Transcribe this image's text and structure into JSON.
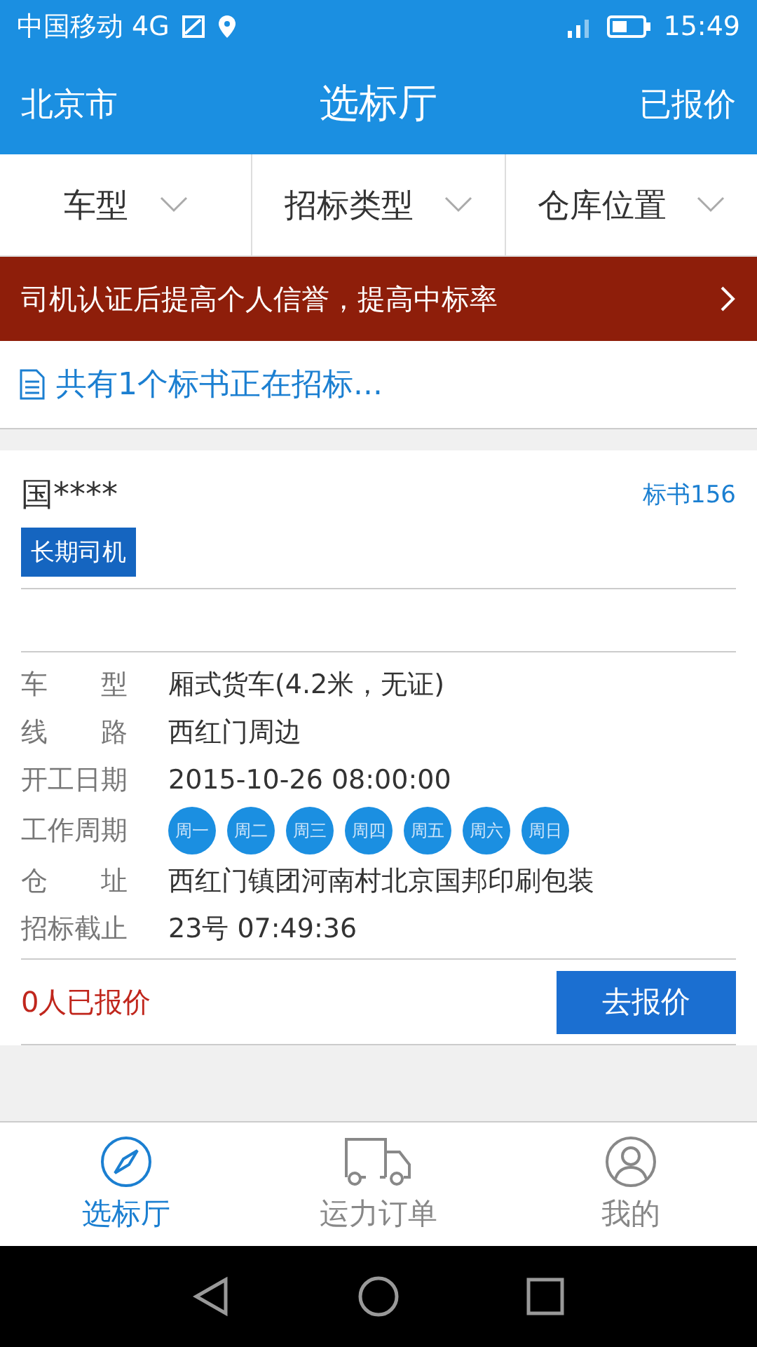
{
  "status_bar": {
    "carrier": "中国移动 4G",
    "time": "15:49"
  },
  "header": {
    "left": "北京市",
    "title": "选标厅",
    "right": "已报价"
  },
  "filters": [
    {
      "label": "车型"
    },
    {
      "label": "招标类型"
    },
    {
      "label": "仓库位置"
    }
  ],
  "banner": {
    "text": "司机认证后提高个人信誉，提高中标率"
  },
  "notice": {
    "text": "共有1个标书正在招标..."
  },
  "card": {
    "name": "国****",
    "bid_no": "标书156",
    "tag": "长期司机",
    "details": [
      {
        "kind": "text",
        "label": "车　　型",
        "value": "厢式货车(4.2米，无证)"
      },
      {
        "kind": "text",
        "label": "线　　路",
        "value": "西红门周边"
      },
      {
        "kind": "text",
        "label": "开工日期",
        "value": "2015-10-26 08:00:00"
      },
      {
        "kind": "days",
        "label": "工作周期",
        "days": [
          "周一",
          "周二",
          "周三",
          "周四",
          "周五",
          "周六",
          "周日"
        ]
      },
      {
        "kind": "text",
        "label": "仓　　址",
        "value": "西红门镇团河南村北京国邦印刷包装"
      },
      {
        "kind": "text",
        "label": "招标截止",
        "value": "23号 07:49:36"
      }
    ],
    "quotes": "0人已报价",
    "action": "去报价"
  },
  "tab_bar": [
    {
      "label": "选标厅",
      "kind": "compass",
      "selected": true
    },
    {
      "label": "运力订单",
      "kind": "truck",
      "selected": false
    },
    {
      "label": "我的",
      "kind": "person",
      "selected": false
    }
  ]
}
